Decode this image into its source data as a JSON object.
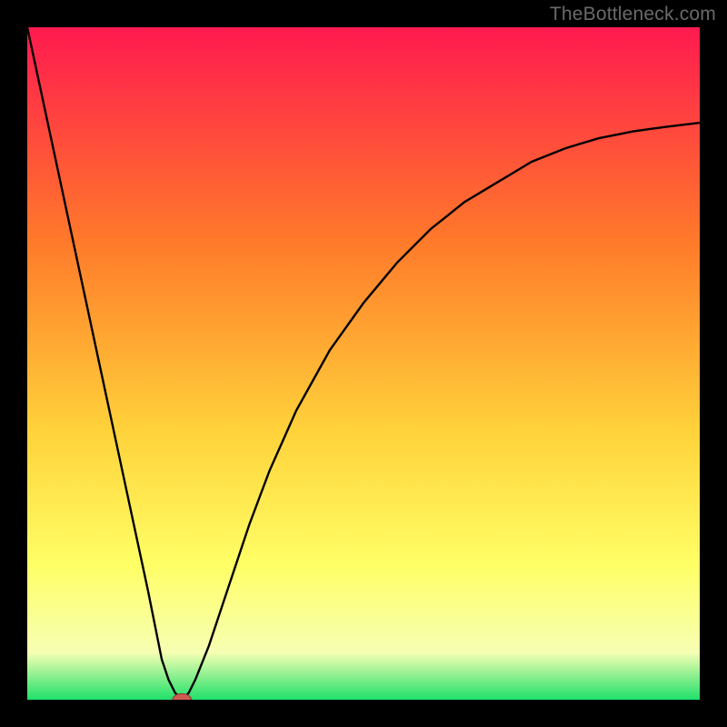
{
  "watermark": "TheBottleneck.com",
  "colors": {
    "bg_black": "#000000",
    "grad_top": "#ff1a4f",
    "grad_mid_upper": "#ff7a2a",
    "grad_mid": "#ffd23a",
    "grad_lower": "#ffff66",
    "grad_pale": "#f6ffb3",
    "grad_green": "#1fe06a",
    "curve": "#000000",
    "marker_fill": "#cf5a52",
    "marker_stroke": "#8a3a34"
  },
  "chart_data": {
    "type": "line",
    "title": "",
    "xlabel": "",
    "ylabel": "",
    "xlim": [
      0,
      100
    ],
    "ylim": [
      0,
      100
    ],
    "series": [
      {
        "name": "bottleneck-curve",
        "x": [
          0,
          3,
          6,
          9,
          12,
          15,
          18,
          20,
          21,
          22,
          23,
          24,
          25,
          27,
          29,
          31,
          33,
          36,
          40,
          45,
          50,
          55,
          60,
          65,
          70,
          75,
          80,
          85,
          90,
          95,
          100
        ],
        "y": [
          100,
          86,
          72,
          58,
          44,
          30,
          16,
          6,
          3,
          1,
          0,
          1,
          3,
          8,
          14,
          20,
          26,
          34,
          43,
          52,
          59,
          65,
          70,
          74,
          77,
          80,
          82,
          83.5,
          84.5,
          85.2,
          85.8
        ]
      }
    ],
    "marker": {
      "x": 23,
      "y": 0,
      "rx": 1.4,
      "ry": 0.9
    },
    "gradient_stops": [
      {
        "offset": 0.0,
        "color_key": "grad_top"
      },
      {
        "offset": 0.32,
        "color_key": "grad_mid_upper"
      },
      {
        "offset": 0.6,
        "color_key": "grad_mid"
      },
      {
        "offset": 0.8,
        "color_key": "grad_lower"
      },
      {
        "offset": 0.93,
        "color_key": "grad_pale"
      },
      {
        "offset": 1.0,
        "color_key": "grad_green"
      }
    ]
  }
}
